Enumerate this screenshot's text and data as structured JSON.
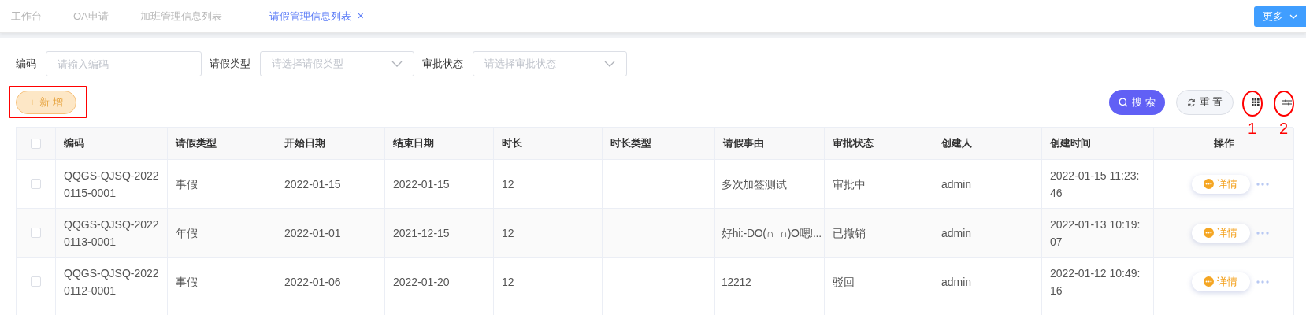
{
  "tabs": [
    {
      "label": "工作台",
      "selected": false
    },
    {
      "label": "OA申请",
      "selected": false
    },
    {
      "label": "加班管理信息列表",
      "selected": false
    },
    {
      "label": "请假管理信息列表",
      "selected": true
    }
  ],
  "close_tab": "×",
  "more_button": "更多",
  "filters": [
    {
      "kind": "input",
      "label": "编码",
      "placeholder": "请输入编码"
    },
    {
      "kind": "select",
      "label": "请假类型",
      "placeholder": "请选择请假类型"
    },
    {
      "kind": "select",
      "label": "审批状态",
      "placeholder": "请选择审批状态"
    }
  ],
  "add_button": {
    "icon": "+",
    "label": "新 增"
  },
  "search_button": "搜 索",
  "reset_button": "重 置",
  "annotations": [
    "1",
    "2"
  ],
  "table": {
    "select_all_checked": false,
    "columns": [
      "编码",
      "请假类型",
      "开始日期",
      "结束日期",
      "时长",
      "时长类型",
      "请假事由",
      "审批状态",
      "创建人",
      "创建时间",
      "操作"
    ],
    "rows": [
      {
        "checked": false,
        "cells": [
          "QQGS-QJSQ-20220115-0001",
          "事假",
          "2022-01-15",
          "2022-01-15",
          "12",
          "",
          "多次加签测试",
          "审批中",
          "admin",
          "2022-01-15 11:23:46"
        ],
        "action": "详情"
      },
      {
        "checked": false,
        "cells": [
          "QQGS-QJSQ-20220113-0001",
          "年假",
          "2022-01-01",
          "2021-12-15",
          "12",
          "",
          "好hi:-DO(∩_∩)O嗯!...",
          "已撤销",
          "admin",
          "2022-01-13 10:19:07"
        ],
        "action": "详情"
      },
      {
        "checked": false,
        "cells": [
          "QQGS-QJSQ-20220112-0001",
          "事假",
          "2022-01-06",
          "2022-01-20",
          "12",
          "",
          "12212",
          "驳回",
          "admin",
          "2022-01-12 10:49:16"
        ],
        "action": "详情"
      }
    ]
  }
}
